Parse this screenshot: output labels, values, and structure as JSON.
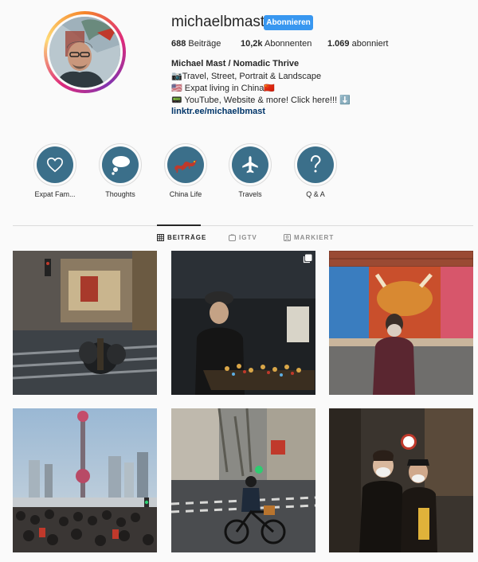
{
  "profile": {
    "username": "michaelbmast",
    "follow_label": "Abonnieren",
    "stats": {
      "posts_count": "688",
      "posts_label": "Beiträge",
      "followers_count": "10,2k",
      "followers_label": "Abonnenten",
      "following_count": "1.069",
      "following_label": "abonniert"
    },
    "bio": {
      "name": "Michael Mast / Nomadic Thrive",
      "line1": "📷Travel, Street, Portrait & Landscape",
      "line2": "🇺🇸 Expat living in China🇨🇳",
      "line3": "📟 YouTube, Website & more! Click here!!! ⬇️",
      "link": "linktr.ee/michaelbmast"
    }
  },
  "highlights": [
    {
      "label": "Expat Fam...",
      "icon": "heart-icon"
    },
    {
      "label": "Thoughts",
      "icon": "thought-bubble-icon"
    },
    {
      "label": "China Life",
      "icon": "dragon-icon"
    },
    {
      "label": "Travels",
      "icon": "airplane-icon"
    },
    {
      "label": "Q & A",
      "icon": "question-icon"
    }
  ],
  "tabs": [
    {
      "label": "BEITRÄGE",
      "icon": "grid-icon",
      "active": true
    },
    {
      "label": "IGTV",
      "icon": "igtv-icon",
      "active": false
    },
    {
      "label": "MARKIERT",
      "icon": "tagged-icon",
      "active": false
    }
  ],
  "posts": [
    {
      "name": "gucci-street-crossing"
    },
    {
      "name": "street-vendor-night",
      "badge": "carousel-icon"
    },
    {
      "name": "mural-woman-mask"
    },
    {
      "name": "oriental-pearl-tower-crowd"
    },
    {
      "name": "cyclist-street"
    },
    {
      "name": "masked-couple"
    }
  ],
  "colors": {
    "accent": "#3897f0",
    "link": "#003569",
    "highlight": "#3b6f8a",
    "divider": "#dbdbdb"
  }
}
